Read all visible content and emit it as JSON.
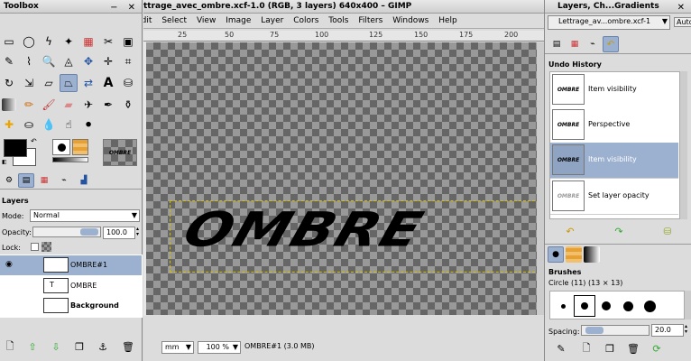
{
  "toolbox": {
    "title": "Toolbox",
    "pattern_label": "OMBRE",
    "colors": {
      "fg": "#000000",
      "bg": "#ffffff"
    }
  },
  "layers_dock": {
    "title": "Layers",
    "mode_label": "Mode:",
    "mode_value": "Normal",
    "opacity_label": "Opacity:",
    "opacity_value": "100.0",
    "lock_label": "Lock:",
    "layers": [
      {
        "name": "OMBRE#1",
        "selected": true
      },
      {
        "name": "OMBRE",
        "selected": false
      },
      {
        "name": "Background",
        "selected": false
      }
    ]
  },
  "image_window": {
    "title": "ttrage_avec_ombre.xcf-1.0 (RGB, 3 layers) 640x400 – GIMP",
    "menu": [
      "Edit",
      "Select",
      "View",
      "Image",
      "Layer",
      "Colors",
      "Tools",
      "Filters",
      "Windows",
      "Help"
    ],
    "ruler_ticks": [
      "25",
      "50",
      "75",
      "100",
      "125",
      "150",
      "175",
      "200"
    ],
    "canvas_text": "OMBRE",
    "status": {
      "unit": "mm",
      "zoom": "100 %",
      "info": "OMBRE#1 (3.0 MB)"
    }
  },
  "right_dock": {
    "title": "Layers, Ch...Gradients",
    "image_selector": "Lettrage_av...ombre.xcf-1",
    "auto_label": "Auto",
    "undo_title": "Undo History",
    "undo_items": [
      {
        "label": "Item visibility",
        "selected": false
      },
      {
        "label": "Perspective",
        "selected": false
      },
      {
        "label": "Item visibility",
        "selected": true
      },
      {
        "label": "Set layer opacity",
        "selected": false
      }
    ],
    "undo_thumb_text": "OMBRE",
    "brushes_title": "Brushes",
    "brush_name": "Circle (11) (13 × 13)",
    "spacing_label": "Spacing:",
    "spacing_value": "20.0"
  }
}
